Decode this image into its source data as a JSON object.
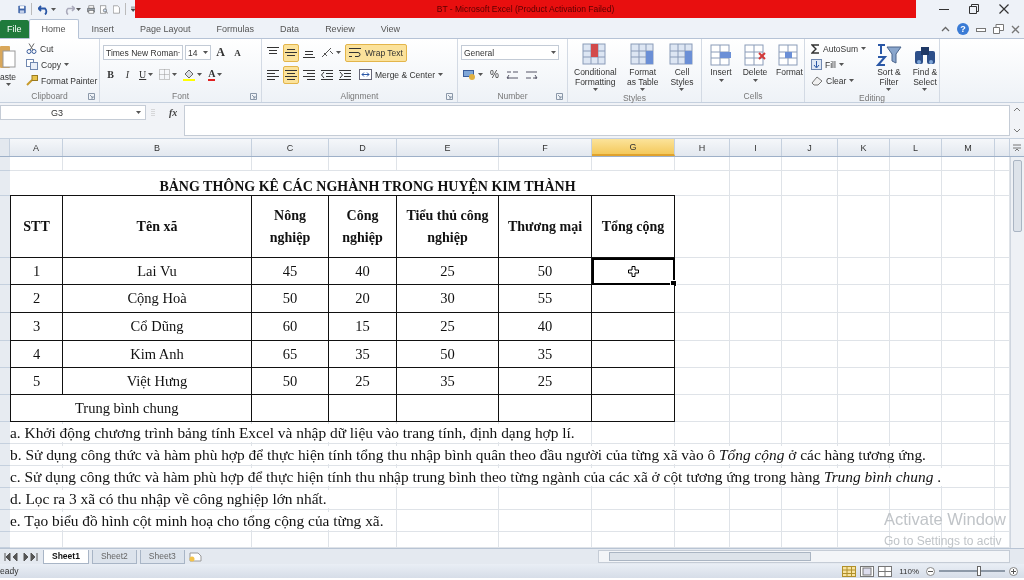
{
  "title_bar": {
    "title": "BT - Microsoft Excel (Product Activation Failed)"
  },
  "tabs": [
    {
      "label": "File",
      "kind": "file",
      "selected": false
    },
    {
      "label": "Home",
      "kind": "tab",
      "selected": true
    },
    {
      "label": "Insert",
      "kind": "tab",
      "selected": false
    },
    {
      "label": "Page Layout",
      "kind": "tab",
      "selected": false
    },
    {
      "label": "Formulas",
      "kind": "tab",
      "selected": false
    },
    {
      "label": "Data",
      "kind": "tab",
      "selected": false
    },
    {
      "label": "Review",
      "kind": "tab",
      "selected": false
    },
    {
      "label": "View",
      "kind": "tab",
      "selected": false
    }
  ],
  "help": "?",
  "ribbon": {
    "clipboard": {
      "label": "Clipboard",
      "paste": "aste",
      "cut": "Cut",
      "copy": "Copy",
      "format_painter": "Format Painter"
    },
    "font": {
      "label": "Font",
      "font_name": "Times New Roman",
      "font_size": "14",
      "grow": "A",
      "shrink": "A",
      "bold": "B",
      "italic": "I",
      "underline": "U",
      "font_color": "A"
    },
    "alignment": {
      "label": "Alignment",
      "vertical": [
        {
          "selected": false
        },
        {
          "selected": true
        },
        {
          "selected": false
        }
      ],
      "horizontal": [
        {
          "selected": false
        },
        {
          "selected": true
        },
        {
          "selected": false
        }
      ],
      "wrap_text": {
        "label": "Wrap Text",
        "selected": true
      },
      "merge": "Merge & Center"
    },
    "number": {
      "label": "Number",
      "format": "General",
      "percent": "%"
    },
    "styles": {
      "label": "Styles",
      "buttons": [
        "Conditional Formatting",
        "Format as Table",
        "Cell Styles"
      ]
    },
    "cells": {
      "label": "Cells",
      "buttons": [
        "Insert",
        "Delete",
        "Format"
      ]
    },
    "editing": {
      "label": "Editing",
      "autosum": "AutoSum",
      "fill": "Fill",
      "clear": "Clear",
      "buttons": [
        "Sort & Filter",
        "Find & Select"
      ]
    }
  },
  "formula_bar": {
    "name_box": "G3",
    "function_label": "fx"
  },
  "columns": [
    {
      "label": "A",
      "selected": false
    },
    {
      "label": "B",
      "selected": false
    },
    {
      "label": "C",
      "selected": false
    },
    {
      "label": "D",
      "selected": false
    },
    {
      "label": "E",
      "selected": false
    },
    {
      "label": "F",
      "selected": false
    },
    {
      "label": "G",
      "selected": true
    },
    {
      "label": "H",
      "selected": false
    },
    {
      "label": "I",
      "selected": false
    },
    {
      "label": "J",
      "selected": false
    },
    {
      "label": "K",
      "selected": false
    },
    {
      "label": "L",
      "selected": false
    },
    {
      "label": "M",
      "selected": false
    }
  ],
  "sheet": {
    "title": "BẢNG THÔNG KÊ CÁC NGHÀNH TRONG HUYỆN KIM THÀNH",
    "headers": [
      "STT",
      "Tên xã",
      "Nông nghiệp",
      "Công nghiệp",
      "Tiểu thủ công nghiệp",
      "Thương mại",
      "Tổng cộng"
    ],
    "rows": [
      {
        "stt": "1",
        "name": "Lai Vu",
        "values": [
          "45",
          "40",
          "25",
          "50"
        ],
        "total_selected": true
      },
      {
        "stt": "2",
        "name": "Cộng Hoà",
        "values": [
          "50",
          "20",
          "30",
          "55"
        ],
        "total_selected": false
      },
      {
        "stt": "3",
        "name": "Cổ Dũng",
        "values": [
          "60",
          "15",
          "25",
          "40"
        ],
        "total_selected": false
      },
      {
        "stt": "4",
        "name": "Kim Anh",
        "values": [
          "65",
          "35",
          "50",
          "35"
        ],
        "total_selected": false
      },
      {
        "stt": "5",
        "name": "Việt Hưng",
        "values": [
          "50",
          "25",
          "35",
          "25"
        ],
        "total_selected": false
      }
    ],
    "average_label": "Trung bình chung",
    "notes": [
      "a. Khởi động chương trình bảng tính Excel và nhập dữ liệu vào trang tính, định dạng hợp lí.",
      "b. Sử dụng công thức và hàm phù hợp để thực hiện tính tổng thu nhập bình quân theo đầu người của từng xã vào ô *Tổng cộng* ở các hàng tương ứng.",
      "c. Sử dụng công thức và hàm phù hợp để thực hiện tính thu nhập trung bình theo từng ngành của các xã ở cột tương ứng trong hàng *Trung bình chung* .",
      "d. Lọc ra 3 xã có thu nhập về công nghiệp lớn nhất.",
      "e. Tạo biểu đồ hình cột minh hoạ cho tổng cộng của từng xã."
    ]
  },
  "sheet_tabs": [
    {
      "label": "Sheet1",
      "selected": true
    },
    {
      "label": "Sheet2",
      "selected": false
    },
    {
      "label": "Sheet3",
      "selected": false
    }
  ],
  "status_bar": {
    "status": "eady",
    "zoom": "110%",
    "zoom_slider": {
      "level": 0.6
    }
  },
  "activation_notice": {
    "title": "Activate Window",
    "subtitle": "Go to Settings to activ"
  }
}
